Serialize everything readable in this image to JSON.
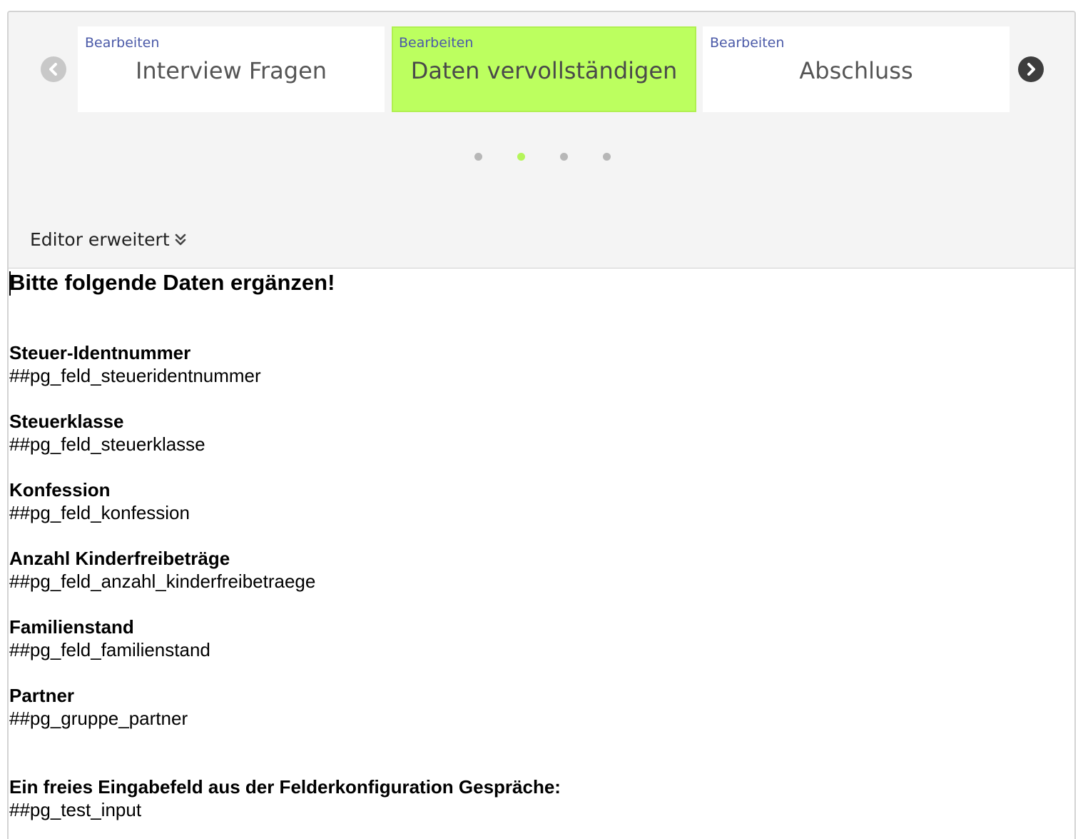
{
  "carousel": {
    "cards": [
      {
        "edit_label": "Bearbeiten",
        "title": "Interview Fragen",
        "active": false
      },
      {
        "edit_label": "Bearbeiten",
        "title": "Daten vervollständigen",
        "active": true
      },
      {
        "edit_label": "Bearbeiten",
        "title": "Abschluss",
        "active": false
      }
    ],
    "pagination": {
      "count": 4,
      "active_index": 1
    },
    "colors": {
      "active_card": "#bcff5f",
      "active_dot": "#b5f55a",
      "inactive_dot": "#b7b7b7",
      "link": "#4b5aa8"
    }
  },
  "editor": {
    "toggle_label": "Editor erweitert",
    "toggle_icon": "double-chevron-down-icon"
  },
  "document": {
    "heading": "Bitte folgende Daten ergänzen!",
    "fields": [
      {
        "label": "Steuer-Identnummer",
        "code": "##pg_feld_steueridentnummer"
      },
      {
        "label": "Steuerklasse",
        "code": "##pg_feld_steuerklasse"
      },
      {
        "label": "Konfession",
        "code": "##pg_feld_konfession"
      },
      {
        "label": "Anzahl Kinderfreibeträge",
        "code": "##pg_feld_anzahl_kinderfreibetraege"
      },
      {
        "label": "Familienstand",
        "code": "##pg_feld_familienstand"
      },
      {
        "label": "Partner",
        "code": "##pg_gruppe_partner"
      },
      {
        "label": "Ein freies Eingabefeld aus der Felderkonfiguration Gespräche:",
        "code": "##pg_test_input"
      }
    ]
  }
}
